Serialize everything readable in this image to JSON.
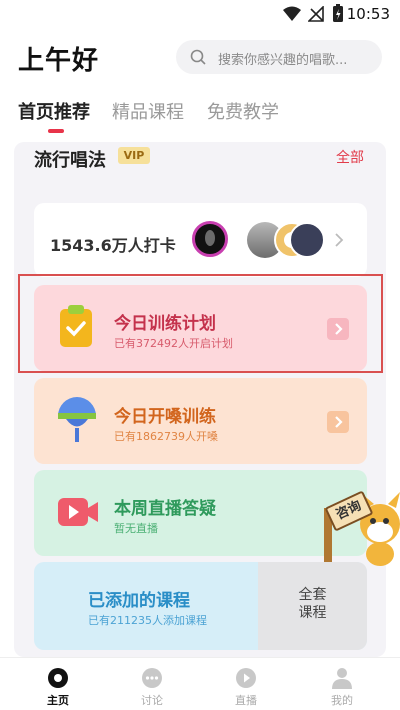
{
  "status": {
    "time": "10:53"
  },
  "header": {
    "greeting": "上午好",
    "search_placeholder": "搜索你感兴趣的唱歌..."
  },
  "tabs": [
    {
      "label": "首页推荐",
      "active": true
    },
    {
      "label": "精品课程",
      "active": false
    },
    {
      "label": "免费教学",
      "active": false
    }
  ],
  "section": {
    "title": "流行唱法",
    "badge": "VIP",
    "all_link": "全部"
  },
  "checkin": {
    "count_text": "1543.6万人打卡"
  },
  "cards": {
    "plan": {
      "title": "今日训练计划",
      "subtitle": "已有372492人开启计划"
    },
    "warmup": {
      "title": "今日开嗓训练",
      "subtitle": "已有1862739人开嗓"
    },
    "live": {
      "title": "本周直播答疑",
      "subtitle": "暂无直播",
      "mascot_sign": "咨询"
    },
    "courses": {
      "title": "已添加的课程",
      "subtitle": "已有211235人添加课程",
      "side_label_line1": "全套",
      "side_label_line2": "课程"
    }
  },
  "bottom_nav": [
    {
      "label": "主页",
      "icon": "home-icon",
      "active": true
    },
    {
      "label": "讨论",
      "icon": "chat-icon",
      "active": false
    },
    {
      "label": "直播",
      "icon": "live-icon",
      "active": false
    },
    {
      "label": "我的",
      "icon": "profile-icon",
      "active": false
    }
  ],
  "colors": {
    "accent": "#e8344a",
    "plan_bg": "#fdd8dc",
    "warmup_bg": "#fde3d2",
    "live_bg": "#d6f2e3",
    "courses_bg": "#d6eef8"
  }
}
